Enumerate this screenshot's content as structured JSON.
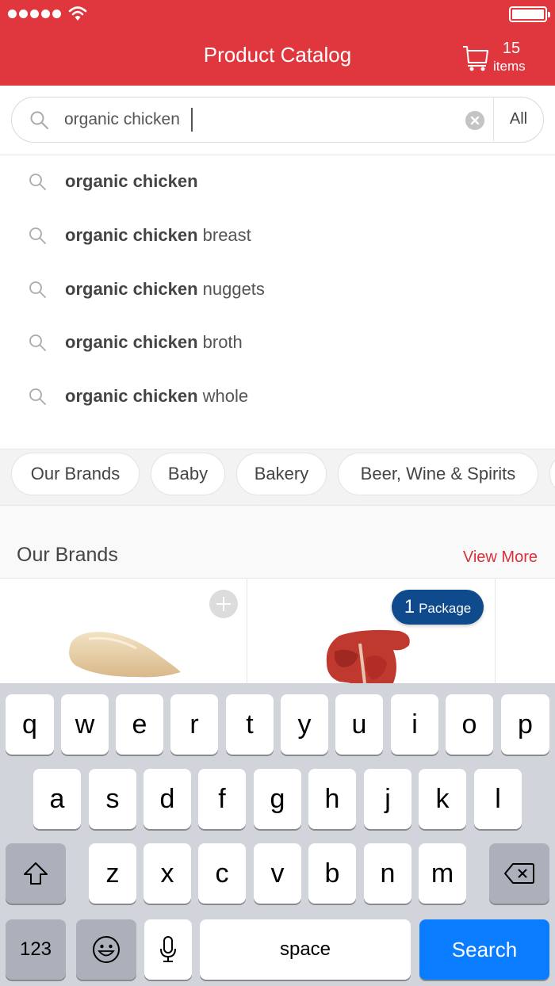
{
  "status_bar": {
    "signal_dots": 5,
    "wifi_icon": "wifi-icon",
    "battery_icon": "battery-icon"
  },
  "header": {
    "title": "Product Catalog",
    "cart": {
      "icon": "cart-icon",
      "count": "15",
      "label": "items"
    }
  },
  "search": {
    "value": "organic chicken",
    "placeholder": "",
    "clear_icon": "clear-icon",
    "scope_label": "All"
  },
  "suggestions": [
    {
      "bold": "organic chicken",
      "rest": ""
    },
    {
      "bold": "organic chicken",
      "rest": " breast"
    },
    {
      "bold": "organic chicken",
      "rest": " nuggets"
    },
    {
      "bold": "organic chicken",
      "rest": " broth"
    },
    {
      "bold": "organic chicken",
      "rest": " whole"
    }
  ],
  "categories": [
    "Our Brands",
    "Baby",
    "Bakery",
    "Beer, Wine & Spirits"
  ],
  "section": {
    "title": "Our Brands",
    "view_more": "View More"
  },
  "products": [
    {
      "image": "chicken-breast-image",
      "action": "add"
    },
    {
      "image": "t-bone-steak-image",
      "quantity": "1",
      "unit": "Package"
    }
  ],
  "colors": {
    "header_red": "#e0373f",
    "view_more_red": "#d8323b",
    "badge_blue": "#0e4a8c",
    "keyboard_search_blue": "#0a7cff"
  },
  "keyboard": {
    "row1": [
      "q",
      "w",
      "e",
      "r",
      "t",
      "y",
      "u",
      "i",
      "o",
      "p"
    ],
    "row2": [
      "a",
      "s",
      "d",
      "f",
      "g",
      "h",
      "j",
      "k",
      "l"
    ],
    "row3": [
      "z",
      "x",
      "c",
      "v",
      "b",
      "n",
      "m"
    ],
    "numbers_label": "123",
    "space_label": "space",
    "search_label": "Search"
  }
}
